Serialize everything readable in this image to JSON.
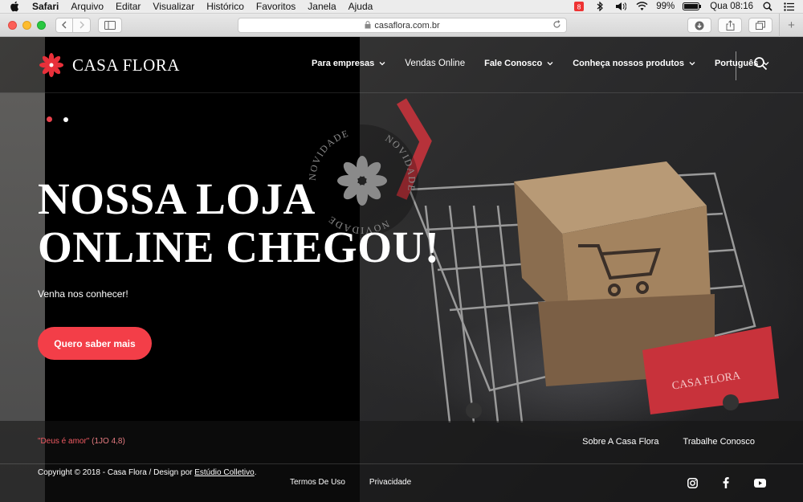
{
  "menubar": {
    "app": "Safari",
    "items": [
      "Arquivo",
      "Editar",
      "Visualizar",
      "Histórico",
      "Favoritos",
      "Janela",
      "Ajuda"
    ],
    "battery": "99%",
    "clock": "Qua 08:16"
  },
  "browser": {
    "url": "casaflora.com.br"
  },
  "site": {
    "logo_text": "CASA FLORA",
    "nav": {
      "empresas": "Para empresas",
      "vendas": "Vendas Online",
      "fale": "Fale Conosco",
      "produtos": "Conheça nossos produtos",
      "idioma": "Português"
    },
    "stamp_text": "NOVIDADE",
    "hero": {
      "title_line1": "NOSSA LOJA",
      "title_line2": "ONLINE CHEGOU!",
      "subtitle": "Venha nos conhecer!",
      "cta": "Quero saber mais"
    },
    "cart_label": "CASA FLORA",
    "footer": {
      "quote": "\"Deus é amor\"",
      "quote_ref": "(1JO 4,8)",
      "link_sobre": "Sobre A Casa Flora",
      "link_trabalhe": "Trabalhe Conosco",
      "copyright": "Copyright © 2018 - Casa Flora / Design por ",
      "studio": "Estúdio Colletivo",
      "copyright_end": ".",
      "termos": "Termos De Uso",
      "privacidade": "Privacidade"
    }
  },
  "colors": {
    "accent": "#f33e48",
    "logo_red": "#e8303a"
  }
}
